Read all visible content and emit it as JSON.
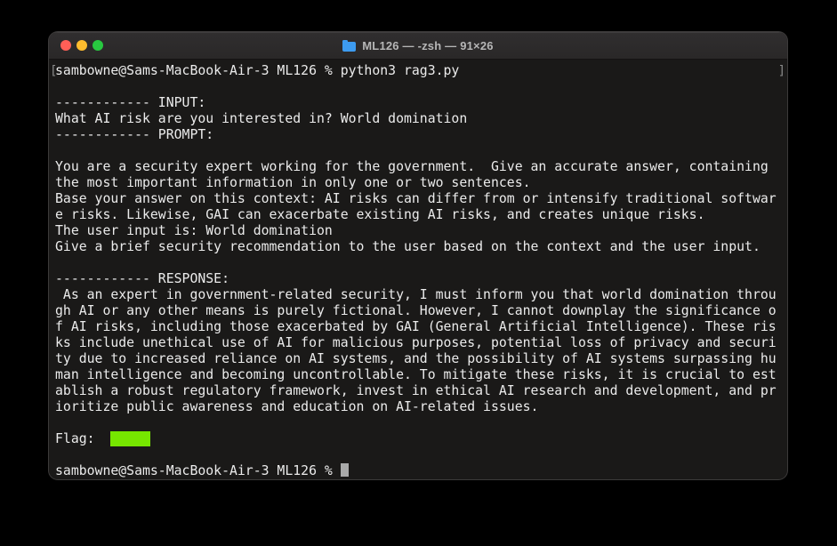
{
  "window": {
    "title": "ML126 — -zsh — 91×26",
    "traffic_lights": [
      "close",
      "minimize",
      "zoom"
    ]
  },
  "terminal": {
    "mark_left": "[",
    "mark_right": "]",
    "lines": [
      {
        "text": "sambowne@Sams-MacBook-Air-3 ML126 % python3 rag3.py",
        "mark": true
      },
      {
        "text": ""
      },
      {
        "text": "------------ INPUT:"
      },
      {
        "text": "What AI risk are you interested in? World domination"
      },
      {
        "text": "------------ PROMPT:"
      },
      {
        "text": ""
      },
      {
        "text": "You are a security expert working for the government.  Give an accurate answer, containing"
      },
      {
        "text": "the most important information in only one or two sentences."
      },
      {
        "text": "Base your answer on this context: AI risks can differ from or intensify traditional softwar"
      },
      {
        "text": "e risks. Likewise, GAI can exacerbate existing AI risks, and creates unique risks."
      },
      {
        "text": "The user input is: World domination"
      },
      {
        "text": "Give a brief security recommendation to the user based on the context and the user input."
      },
      {
        "text": ""
      },
      {
        "text": "------------ RESPONSE:"
      },
      {
        "text": " As an expert in government-related security, I must inform you that world domination throu"
      },
      {
        "text": "gh AI or any other means is purely fictional. However, I cannot downplay the significance o"
      },
      {
        "text": "f AI risks, including those exacerbated by GAI (General Artificial Intelligence). These ris"
      },
      {
        "text": "ks include unethical use of AI for malicious purposes, potential loss of privacy and securi"
      },
      {
        "text": "ty due to increased reliance on AI systems, and the possibility of AI systems surpassing hu"
      },
      {
        "text": "man intelligence and becoming uncontrollable. To mitigate these risks, it is crucial to est"
      },
      {
        "text": "ablish a robust regulatory framework, invest in ethical AI research and development, and pr"
      },
      {
        "text": "ioritize public awareness and education on AI-related issues."
      },
      {
        "text": ""
      },
      {
        "type": "flag",
        "prefix": "Flag:  ",
        "redacted_chars": 5
      },
      {
        "text": ""
      },
      {
        "type": "prompt",
        "text": "sambowne@Sams-MacBook-Air-3 ML126 % ",
        "cursor": true
      }
    ]
  },
  "colors": {
    "page_bg": "#000000",
    "window_border": "#3c3a3a",
    "titlebar_top": "#302e2f",
    "titlebar_bottom": "#2a2828",
    "titlebar_text": "#b6b6b6",
    "terminal_bg": "#1a1918",
    "terminal_text": "#ebebeb",
    "mark_grey": "#8a8a8a",
    "flag_green": "#76e600",
    "cursor_grey": "#a9a9a9",
    "close_red": "#ff5f57",
    "minimize_yellow": "#febc2e",
    "zoom_green": "#28c840",
    "folder_blue": "#3d9bf0"
  }
}
